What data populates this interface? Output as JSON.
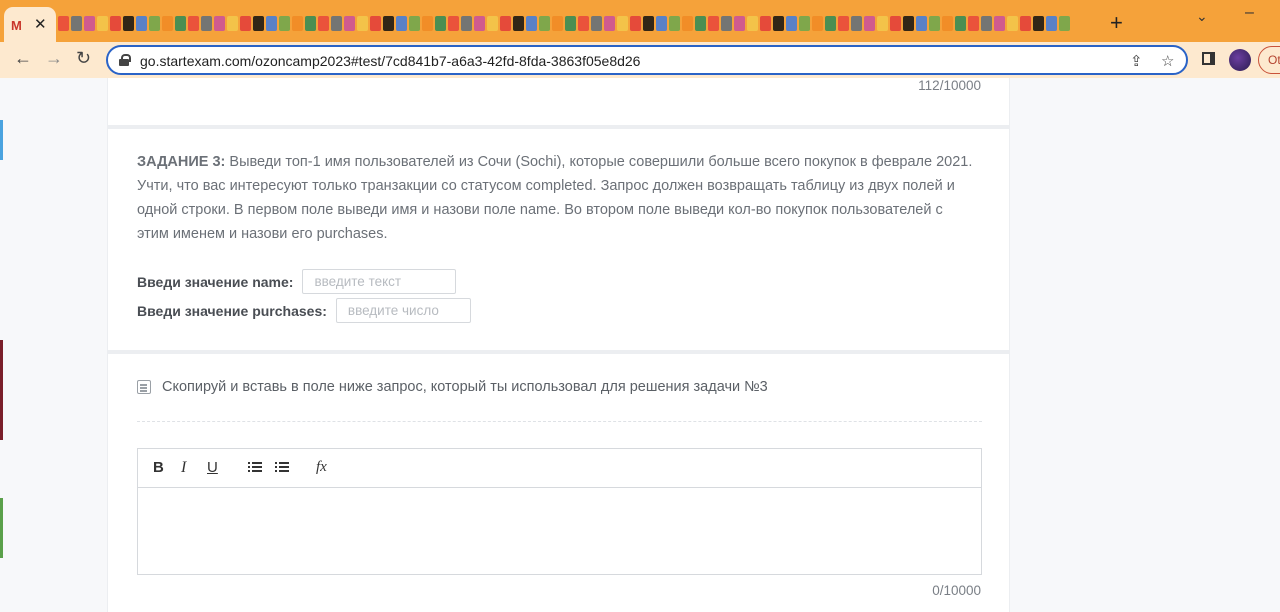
{
  "browser": {
    "url": "go.startexam.com/ozoncamp2023#test/7cd841b7-a6a3-42fd-8fda-3863f05e8d26",
    "ext_label": "Ot"
  },
  "page": {
    "top_counter": "112/10000",
    "task": {
      "heading": "ЗАДАНИЕ 3:",
      "body": " Выведи топ-1 имя пользователей из Сочи (Sochi), которые совершили больше всего покупок в феврале 2021. Учти, что вас интересуют только транзакции со статусом completed. Запрос должен возвращать таблицу из двух полей и одной строки. В первом поле выведи имя и назови поле name. Во втором поле выведи кол-во покупок пользователей с этим именем и назови его purchases.",
      "name_label": "Введи значение name:",
      "name_placeholder": "введите текст",
      "purchases_label": "Введи значение purchases:",
      "purchases_placeholder": "введите число"
    },
    "question": {
      "text": "Скопируй и вставь в поле ниже запрос, который ты использовал для решения задачи №3"
    },
    "editor": {
      "bold": "B",
      "italic": "I",
      "underline": "U",
      "formula": "fx"
    },
    "bottom_counter": "0/10000"
  }
}
